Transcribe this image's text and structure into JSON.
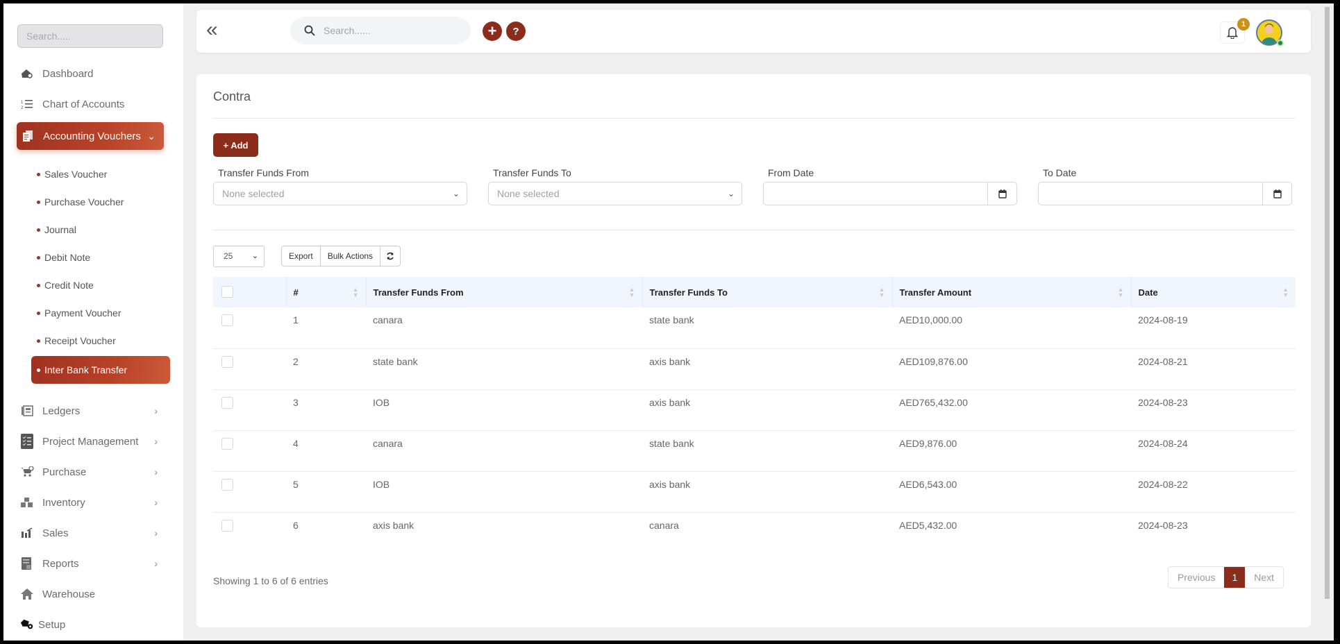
{
  "sidebar": {
    "search_placeholder": "Search.....",
    "items": [
      {
        "label": "Dashboard",
        "icon": "dashboard-icon"
      },
      {
        "label": "Chart of Accounts",
        "icon": "numbered-list-icon"
      },
      {
        "label": "Accounting Vouchers",
        "icon": "vouchers-icon",
        "expanded": true
      },
      {
        "label": "Ledgers",
        "icon": "ledger-icon"
      },
      {
        "label": "Project Management",
        "icon": "checklist-icon"
      },
      {
        "label": "Purchase",
        "icon": "cart-icon"
      },
      {
        "label": "Inventory",
        "icon": "boxes-icon"
      },
      {
        "label": "Sales",
        "icon": "sales-chart-icon"
      },
      {
        "label": "Reports",
        "icon": "reports-icon"
      },
      {
        "label": "Warehouse",
        "icon": "home-icon"
      },
      {
        "label": "Setup",
        "icon": "setup-gear-icon"
      }
    ],
    "sub_items": [
      {
        "label": "Sales Voucher"
      },
      {
        "label": "Purchase Voucher"
      },
      {
        "label": "Journal"
      },
      {
        "label": "Debit Note"
      },
      {
        "label": "Credit Note"
      },
      {
        "label": "Payment Voucher"
      },
      {
        "label": "Receipt Voucher"
      },
      {
        "label": "Inter Bank Transfer",
        "active": true
      }
    ]
  },
  "topbar": {
    "search_placeholder": "Search......",
    "add_label": "+",
    "help_label": "?",
    "notification_count": "1"
  },
  "page": {
    "title": "Contra",
    "add_button": "+ Add",
    "filters": {
      "from_label": "Transfer Funds From",
      "from_value": "None selected",
      "to_label": "Transfer Funds To",
      "to_value": "None selected",
      "from_date_label": "From Date",
      "from_date_value": "",
      "to_date_label": "To Date",
      "to_date_value": ""
    },
    "page_length": "25",
    "export_label": "Export",
    "bulk_actions_label": "Bulk Actions",
    "table": {
      "columns": [
        "#",
        "Transfer Funds From",
        "Transfer Funds To",
        "Transfer Amount",
        "Date"
      ],
      "rows": [
        {
          "no": "1",
          "from": "canara",
          "to": "state bank",
          "amount": "AED10,000.00",
          "date": "2024-08-19"
        },
        {
          "no": "2",
          "from": "state bank",
          "to": "axis bank",
          "amount": "AED109,876.00",
          "date": "2024-08-21"
        },
        {
          "no": "3",
          "from": "IOB",
          "to": "axis bank",
          "amount": "AED765,432.00",
          "date": "2024-08-23"
        },
        {
          "no": "4",
          "from": "canara",
          "to": "state bank",
          "amount": "AED9,876.00",
          "date": "2024-08-24"
        },
        {
          "no": "5",
          "from": "IOB",
          "to": "axis bank",
          "amount": "AED6,543.00",
          "date": "2024-08-22"
        },
        {
          "no": "6",
          "from": "axis bank",
          "to": "canara",
          "amount": "AED5,432.00",
          "date": "2024-08-23"
        }
      ]
    },
    "info": "Showing 1 to 6 of 6 entries",
    "pagination": {
      "previous": "Previous",
      "current": "1",
      "next": "Next"
    }
  },
  "colors": {
    "brand": "#8c2d1c",
    "badge": "#c9901a",
    "online": "#1a8a2a"
  }
}
